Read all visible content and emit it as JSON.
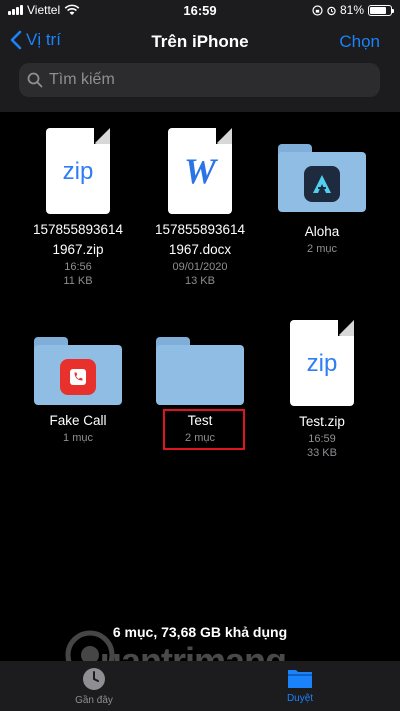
{
  "status_bar": {
    "carrier": "Viettel",
    "time": "16:59",
    "battery": "81%",
    "battery_level": 0.81
  },
  "nav": {
    "back_label": "Vị trí",
    "title": "Trên iPhone",
    "select_label": "Chọn"
  },
  "search": {
    "placeholder": "Tìm kiếm"
  },
  "items": [
    {
      "name_line1": "157855893614",
      "name_line2": "1967.zip",
      "meta1": "16:56",
      "meta2": "11 KB",
      "icon": "zip-file-icon",
      "icon_text": "zip"
    },
    {
      "name_line1": "157855893614",
      "name_line2": "1967.docx",
      "meta1": "09/01/2020",
      "meta2": "13 KB",
      "icon": "word-document-icon",
      "icon_text": "W"
    },
    {
      "name_line1": "Aloha",
      "meta1": "2 mục",
      "icon": "aloha-folder-icon"
    },
    {
      "name_line1": "Fake Call",
      "meta1": "1 mục",
      "icon": "fake-call-folder-icon"
    },
    {
      "name_line1": "Test",
      "meta1": "2 mục",
      "icon": "folder-icon"
    },
    {
      "name_line1": "Test.zip",
      "meta1": "16:59",
      "meta2": "33 KB",
      "icon": "zip-file-icon",
      "icon_text": "zip"
    }
  ],
  "storage_info": "6 mục, 73,68 GB khả dụng",
  "watermark": "uantrimang",
  "tab_bar": {
    "recents_label": "Gần đây",
    "browse_label": "Duyệt"
  },
  "colors": {
    "accent": "#1a82fb",
    "highlight": "#e0141f",
    "folder": "#8fbde3"
  }
}
